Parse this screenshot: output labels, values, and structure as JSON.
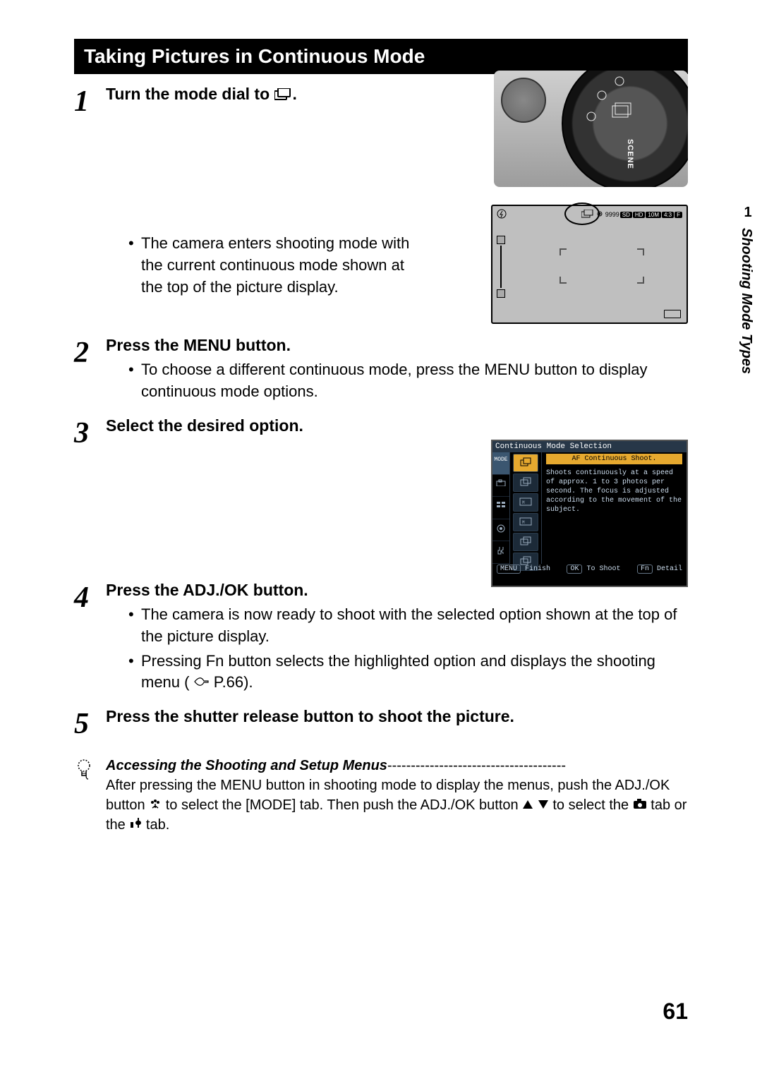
{
  "title": "Taking Pictures in Continuous Mode",
  "chapter": {
    "num": "1",
    "title": "Shooting Mode Types"
  },
  "page_number": "61",
  "steps": {
    "s1": {
      "num": "1",
      "title_prefix": "Turn the mode dial to ",
      "title_suffix": ".",
      "bullet1": "The camera enters shooting mode with the current continuous mode shown at the top of the picture display."
    },
    "s2": {
      "num": "2",
      "title": "Press the MENU button.",
      "bullet1": "To choose a different continuous mode, press the MENU button to display continuous mode options."
    },
    "s3": {
      "num": "3",
      "title": "Select the desired option."
    },
    "s4": {
      "num": "4",
      "title": "Press the ADJ./OK button.",
      "bullet1": "The camera is now ready to shoot with the selected option shown at the top of the picture display.",
      "bullet2_pre": "Pressing Fn button selects the highlighted option and displays the shooting menu (",
      "bullet2_ref": " P.66).",
      "bullet2_ref_page": "P.66"
    },
    "s5": {
      "num": "5",
      "title": "Press the shutter release button to shoot the picture."
    }
  },
  "note": {
    "title": "Accessing the Shooting and Setup Menus",
    "dashes": "--------------------------------------",
    "text1": "After pressing the MENU button in shooting mode to display the menus, push the ADJ./OK button ",
    "text2": " to select the [MODE] tab. Then push the ADJ./OK button ",
    "text3": " to select the ",
    "text4": " tab or the ",
    "text5": " tab."
  },
  "dial": {
    "scene_label": "SCENE"
  },
  "lcd1": {
    "counter": "9999",
    "badges": [
      "SD",
      "HD",
      "10M",
      "4:3",
      "F"
    ]
  },
  "lcd2": {
    "header": "Continuous Mode Selection",
    "left_tabs": [
      "MODE",
      "",
      "",
      "",
      ""
    ],
    "selected_name": "AF Continuous Shoot.",
    "desc": "Shoots continuously at a speed of approx. 1 to 3 photos per second. The focus is adjusted according to the movement of the subject.",
    "footer": {
      "menu_label": "MENU",
      "finish": "Finish",
      "ok_label": "OK",
      "to_shoot": "To Shoot",
      "fn_label": "Fn",
      "detail": "Detail"
    }
  }
}
